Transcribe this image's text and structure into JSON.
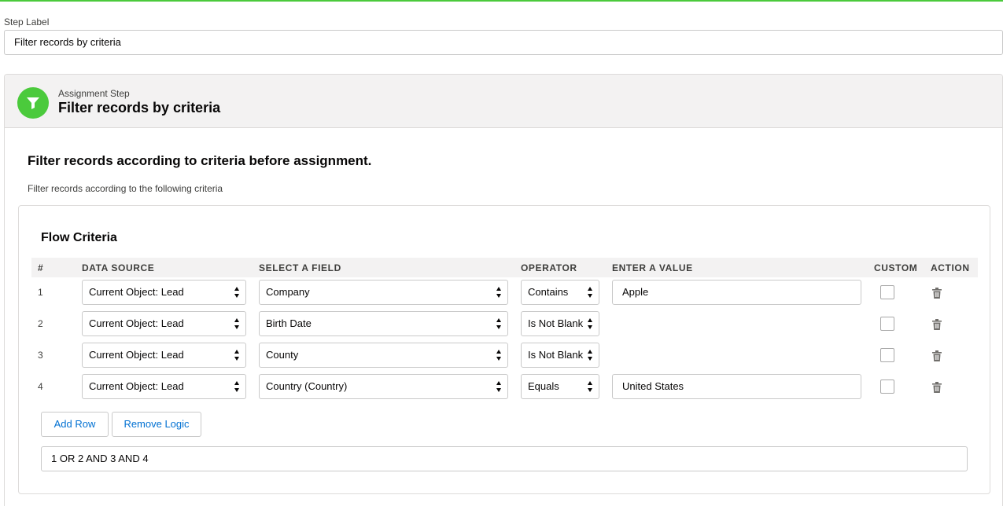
{
  "step": {
    "label": "Step Label",
    "value": "Filter records by criteria"
  },
  "card": {
    "icon": "filter-icon",
    "subtitle": "Assignment Step",
    "title": "Filter records by criteria",
    "heading": "Filter records according to criteria before assignment.",
    "description": "Filter records according to the following criteria",
    "accent_color": "#4bca3c"
  },
  "criteria": {
    "title": "Flow Criteria",
    "columns": {
      "num": "#",
      "data_source": "DATA SOURCE",
      "field": "SELECT A FIELD",
      "operator": "OPERATOR",
      "value": "ENTER A VALUE",
      "custom": "CUSTOM",
      "action": "ACTION"
    },
    "rows": [
      {
        "num": "1",
        "data_source": "Current Object: Lead",
        "field": "Company",
        "operator": "Contains",
        "value": "Apple",
        "custom": false
      },
      {
        "num": "2",
        "data_source": "Current Object: Lead",
        "field": "Birth Date",
        "operator": "Is Not Blank",
        "value": null,
        "custom": false
      },
      {
        "num": "3",
        "data_source": "Current Object: Lead",
        "field": "County",
        "operator": "Is Not Blank",
        "value": null,
        "custom": false
      },
      {
        "num": "4",
        "data_source": "Current Object: Lead",
        "field": "Country (Country)",
        "operator": "Equals",
        "value": "United States",
        "custom": false
      }
    ],
    "buttons": {
      "add_row": "Add Row",
      "remove_logic": "Remove Logic"
    },
    "logic": "1 OR 2 AND 3 AND 4"
  }
}
